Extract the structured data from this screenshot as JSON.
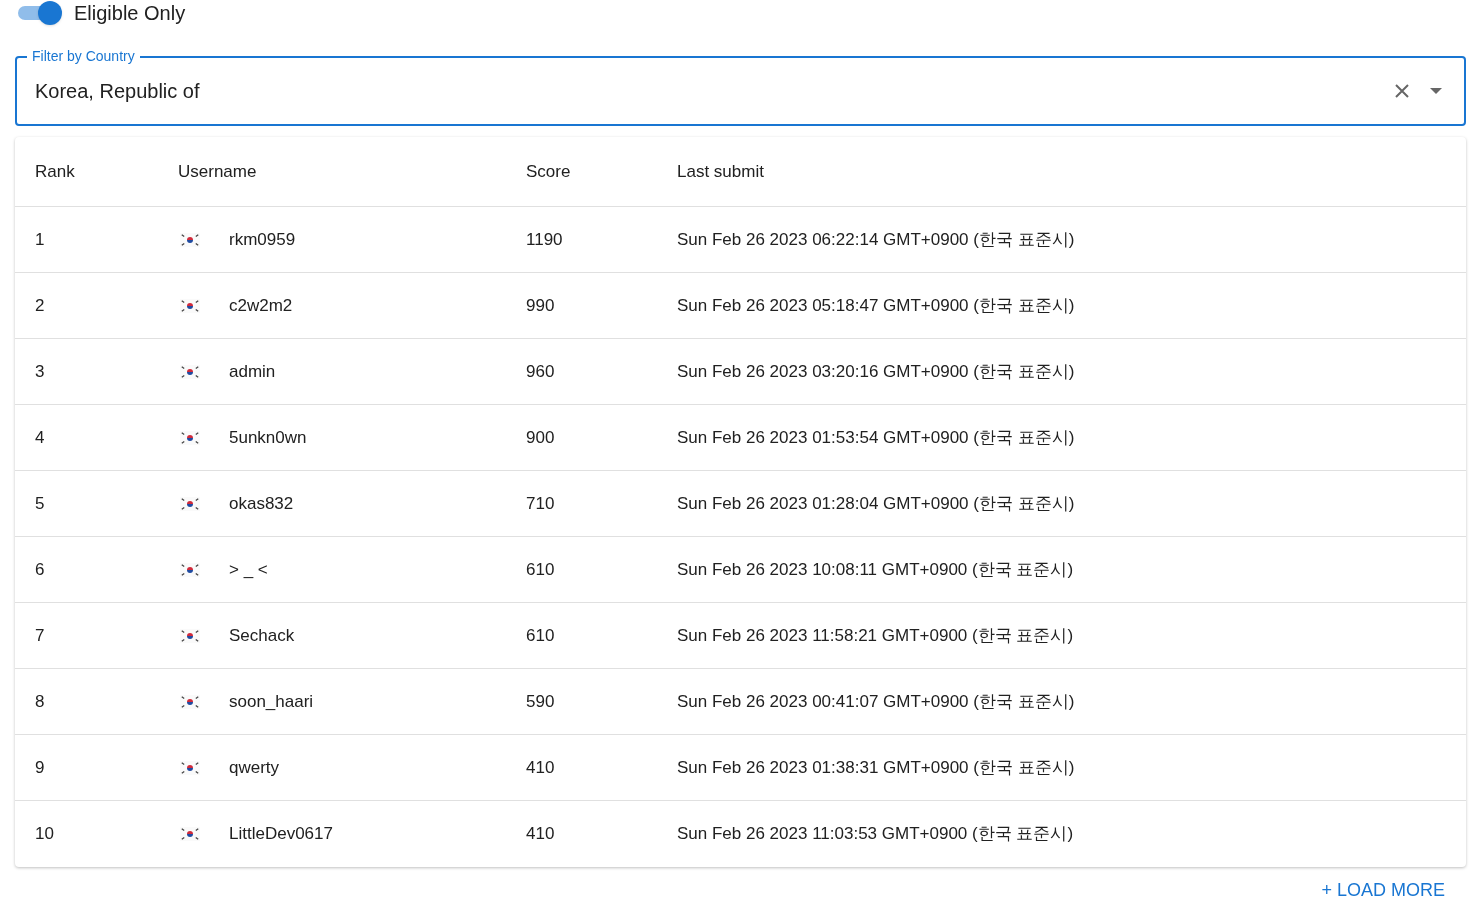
{
  "eligible_toggle": {
    "label": "Eligible Only",
    "on": true
  },
  "country_filter": {
    "label": "Filter by Country",
    "value": "Korea, Republic of",
    "focused": true
  },
  "table": {
    "columns": [
      "Rank",
      "Username",
      "Score",
      "Last submit"
    ],
    "rows": [
      {
        "rank": "1",
        "username": "rkm0959",
        "score": "1190",
        "last_submit": "Sun Feb 26 2023 06:22:14 GMT+0900 (한국 표준시)"
      },
      {
        "rank": "2",
        "username": "c2w2m2",
        "score": "990",
        "last_submit": "Sun Feb 26 2023 05:18:47 GMT+0900 (한국 표준시)"
      },
      {
        "rank": "3",
        "username": "admin",
        "score": "960",
        "last_submit": "Sun Feb 26 2023 03:20:16 GMT+0900 (한국 표준시)"
      },
      {
        "rank": "4",
        "username": "5unkn0wn",
        "score": "900",
        "last_submit": "Sun Feb 26 2023 01:53:54 GMT+0900 (한국 표준시)"
      },
      {
        "rank": "5",
        "username": "okas832",
        "score": "710",
        "last_submit": "Sun Feb 26 2023 01:28:04 GMT+0900 (한국 표준시)"
      },
      {
        "rank": "6",
        "username": "> _ <",
        "score": "610",
        "last_submit": "Sun Feb 26 2023 10:08:11 GMT+0900 (한국 표준시)"
      },
      {
        "rank": "7",
        "username": "Sechack",
        "score": "610",
        "last_submit": "Sun Feb 26 2023 11:58:21 GMT+0900 (한국 표준시)"
      },
      {
        "rank": "8",
        "username": "soon_haari",
        "score": "590",
        "last_submit": "Sun Feb 26 2023 00:41:07 GMT+0900 (한국 표준시)"
      },
      {
        "rank": "9",
        "username": "qwerty",
        "score": "410",
        "last_submit": "Sun Feb 26 2023 01:38:31 GMT+0900 (한국 표준시)"
      },
      {
        "rank": "10",
        "username": "LittleDev0617",
        "score": "410",
        "last_submit": "Sun Feb 26 2023 11:03:53 GMT+0900 (한국 표준시)"
      }
    ]
  },
  "load_more": "+ LOAD MORE"
}
